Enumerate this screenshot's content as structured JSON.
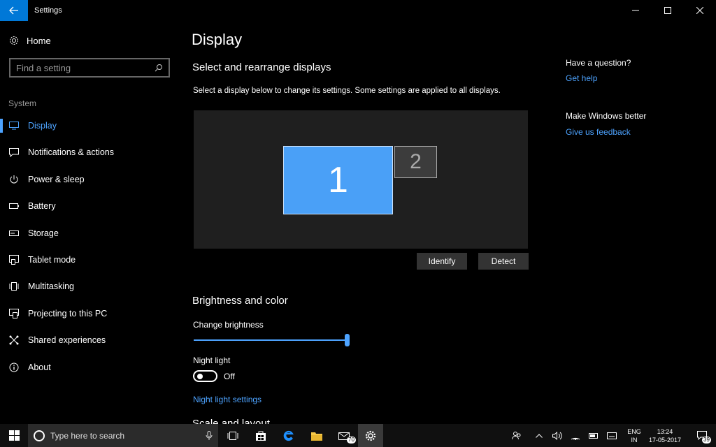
{
  "window": {
    "title": "Settings"
  },
  "sidebar": {
    "home": "Home",
    "search_placeholder": "Find a setting",
    "section": "System",
    "items": [
      {
        "label": "Display",
        "icon": "monitor-icon",
        "active": true
      },
      {
        "label": "Notifications & actions",
        "icon": "message-icon"
      },
      {
        "label": "Power & sleep",
        "icon": "power-icon"
      },
      {
        "label": "Battery",
        "icon": "battery-icon"
      },
      {
        "label": "Storage",
        "icon": "storage-icon"
      },
      {
        "label": "Tablet mode",
        "icon": "tablet-icon"
      },
      {
        "label": "Multitasking",
        "icon": "multitask-icon"
      },
      {
        "label": "Projecting to this PC",
        "icon": "project-icon"
      },
      {
        "label": "Shared experiences",
        "icon": "share-icon"
      },
      {
        "label": "About",
        "icon": "info-icon"
      }
    ]
  },
  "main": {
    "title": "Display",
    "arrange_heading": "Select and rearrange displays",
    "arrange_desc": "Select a display below to change its settings. Some settings are applied to all displays.",
    "monitor1": "1",
    "monitor2": "2",
    "identify": "Identify",
    "detect": "Detect",
    "brightness_heading": "Brightness and color",
    "brightness_label": "Change brightness",
    "brightness_value": 1.0,
    "night_light_label": "Night light",
    "night_light_state": "Off",
    "night_light_link": "Night light settings",
    "next_heading_partial": "Scale and layout"
  },
  "right": {
    "question": "Have a question?",
    "get_help": "Get help",
    "better": "Make Windows better",
    "feedback": "Give us feedback"
  },
  "taskbar": {
    "search_placeholder": "Type here to search",
    "mail_badge": "70",
    "lang_top": "ENG",
    "lang_bottom": "IN",
    "time": "13:24",
    "date": "17-05-2017",
    "notif_badge": "39"
  },
  "colors": {
    "accent": "#4da3ff",
    "monitor_selected": "#4aa0f7",
    "titlebar_back": "#0078d7"
  }
}
